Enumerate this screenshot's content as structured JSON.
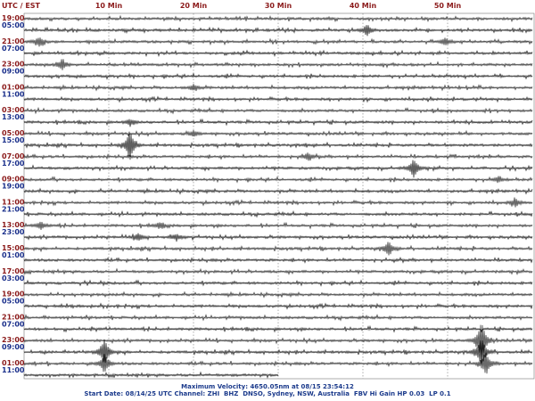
{
  "header": {
    "corner_label": "UTC / EST",
    "minute_labels": [
      {
        "minute": 10,
        "text": "10 Min"
      },
      {
        "minute": 20,
        "text": "20 Min"
      },
      {
        "minute": 30,
        "text": "30 Min"
      },
      {
        "minute": 40,
        "text": "40 Min"
      },
      {
        "minute": 50,
        "text": "50 Min"
      }
    ]
  },
  "time_labels": [
    {
      "utc": "19:00",
      "est": "05:00"
    },
    {
      "utc": "21:00",
      "est": "07:00"
    },
    {
      "utc": "23:00",
      "est": "09:00"
    },
    {
      "utc": "01:00",
      "est": "11:00"
    },
    {
      "utc": "03:00",
      "est": "13:00"
    },
    {
      "utc": "05:00",
      "est": "15:00"
    },
    {
      "utc": "07:00",
      "est": "17:00"
    },
    {
      "utc": "09:00",
      "est": "19:00"
    },
    {
      "utc": "11:00",
      "est": "21:00"
    },
    {
      "utc": "13:00",
      "est": "23:00"
    },
    {
      "utc": "15:00",
      "est": "01:00"
    },
    {
      "utc": "17:00",
      "est": "03:00"
    },
    {
      "utc": "19:00",
      "est": "05:00"
    },
    {
      "utc": "21:00",
      "est": "07:00"
    },
    {
      "utc": "23:00",
      "est": "09:00"
    },
    {
      "utc": "01:00",
      "est": "11:00"
    }
  ],
  "trace_count": 32,
  "last_trace_end_minute": 30,
  "colors": {
    "trace_odd": "#1a1a1a",
    "trace_even": "#2a2a2a",
    "grid": "#777777",
    "utc_label": "#8b1a1a",
    "est_label": "#1a2f8b",
    "footer": "#1c3b8c"
  },
  "events": [
    {
      "trace": 1,
      "minute": 40.5,
      "amp": 6
    },
    {
      "trace": 2,
      "minute": 1.8,
      "amp": 5
    },
    {
      "trace": 2,
      "minute": 49.7,
      "amp": 4
    },
    {
      "trace": 4,
      "minute": 4.5,
      "amp": 5
    },
    {
      "trace": 6,
      "minute": 20,
      "amp": 3
    },
    {
      "trace": 9,
      "minute": 12.5,
      "amp": 3
    },
    {
      "trace": 10,
      "minute": 20,
      "amp": 3
    },
    {
      "trace": 11,
      "minute": 12.5,
      "amp": 16
    },
    {
      "trace": 12,
      "minute": 33.5,
      "amp": 4
    },
    {
      "trace": 13,
      "minute": 46,
      "amp": 10
    },
    {
      "trace": 14,
      "minute": 56,
      "amp": 3
    },
    {
      "trace": 16,
      "minute": 58,
      "amp": 4
    },
    {
      "trace": 18,
      "minute": 2,
      "amp": 4
    },
    {
      "trace": 18,
      "minute": 16,
      "amp": 3
    },
    {
      "trace": 19,
      "minute": 13.5,
      "amp": 4
    },
    {
      "trace": 19,
      "minute": 18,
      "amp": 3
    },
    {
      "trace": 20,
      "minute": 43,
      "amp": 7
    },
    {
      "trace": 28,
      "minute": 54,
      "amp": 22
    },
    {
      "trace": 29,
      "minute": 9.5,
      "amp": 14
    },
    {
      "trace": 29,
      "minute": 54,
      "amp": 16
    },
    {
      "trace": 30,
      "minute": 9.5,
      "amp": 10
    },
    {
      "trace": 30,
      "minute": 54.5,
      "amp": 12
    },
    {
      "trace": 31,
      "minute": 54.5,
      "amp": 6
    }
  ],
  "footer": {
    "line1": "Maximum Velocity: 4650.05nm at 08/15 23:54:12",
    "line2": "Start Date: 08/14/25 UTC Channel: ZHI  BHZ  DNSO, Sydney, NSW, Australia  FBV Hi Gain HP 0.03  LP 0.1"
  }
}
